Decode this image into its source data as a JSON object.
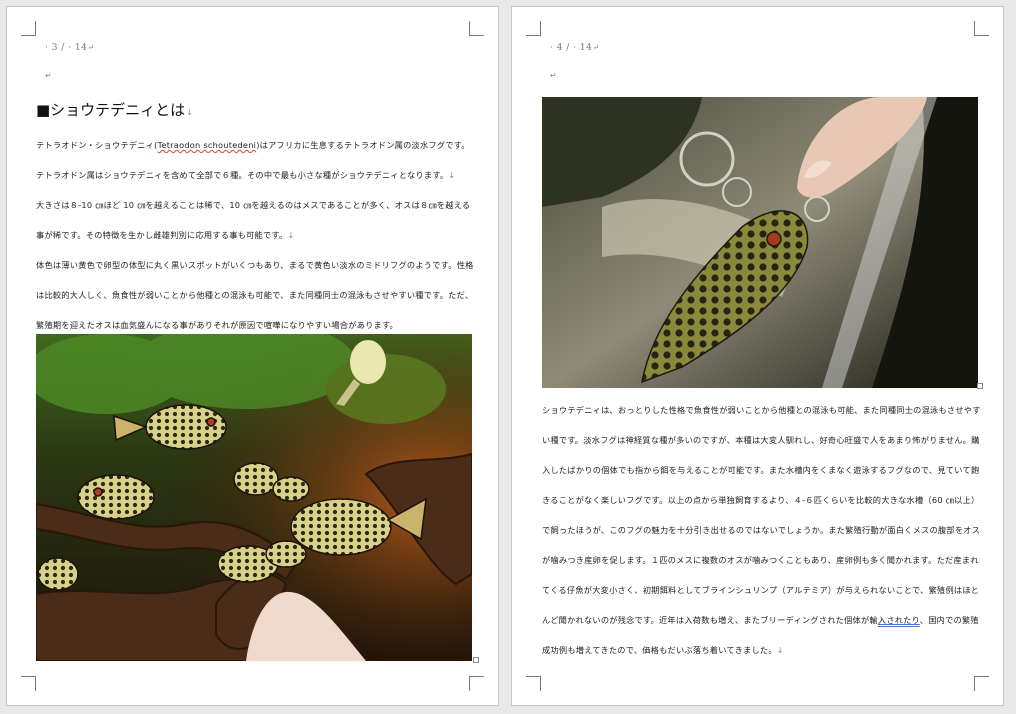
{
  "left_page": {
    "page_number": "· 3 / · 14",
    "heading": "■ショウテデニィとは",
    "paragraphs": [
      {
        "pre": "テトラオドン・ショウテデニィ(",
        "latin": "Tetraodon schoutedeni",
        "post": ")はアフリカに生息するテトラオドン属の淡水フグです。テトラオドン属はショウテデニィを含めて全部で６種。その中で最も小さな種がショウテデニィとなります。"
      },
      {
        "text": "大きさは８-10 ㎝ほど 10 ㎝を越えることは稀で、10 ㎝を越えるのはメスであることが多く、オスは８㎝を越える事が稀です。その特徴を生かし雌雄判別に応用する事も可能です。"
      },
      {
        "text": "体色は薄い黄色で卵型の体型に丸く黒いスポットがいくつもあり、まるで黄色い淡水のミドリフグのようです。性格は比較的大人しく、魚食性が弱いことから他種との混泳も可能で、また同種同士の混泳もさせやすい種です。ただ、繁殖期を迎えたオスは血気盛んになる事がありそれが原因で喧嘩になりやすい場合があります。"
      }
    ],
    "photo_alt": "aquarium-pufferfish-photo"
  },
  "right_page": {
    "page_number": "· 4 / · 14",
    "paragraph_pre": "ショウテデニィは、おっとりした性格で魚食性が弱いことから他種との混泳も可能、また同種同士の混泳もさせやすい種です。淡水フグは神経質な種が多いのですが、本種は大変人馴れし、好奇心旺盛で人をあまり怖がりません。購入したばかりの個体でも指から餌を与えることが可能です。また水槽内をくまなく遊泳するフグなので、見ていて飽きることがなく楽しいフグです。以上の点から単独飼育するより、４-６匹くらいを比較的大きな水槽（60 ㎝以上）で飼ったほうが、このフグの魅力を十分引き出せるのではないでしょうか。また繁殖行動が面白くメスの腹部をオスが噛みつき産卵を促します。１匹のメスに複数のオスが噛みつくこともあり、産卵例も多く聞かれます。ただ産まれてくる仔魚が大変小さく、初期餌料としてブラインシュリンプ（アルテミア）が与えられないことで、繁殖例はほとんど聞かれないのが残念です。近年は入荷数も増え、またブリーディングされた個体が輸",
    "paragraph_marked": "入されたり",
    "paragraph_post": "、国内での繁殖成功例も増えてきたので、価格もだいぶ落ち着いてきました。",
    "photo_alt": "hand-holding-pufferfish-photo"
  },
  "marks": {
    "paragraph": "↵",
    "return": "↓"
  },
  "colors": {
    "page_bg": "#ffffff",
    "canvas_bg": "#e9e9e9",
    "text": "#222222"
  }
}
